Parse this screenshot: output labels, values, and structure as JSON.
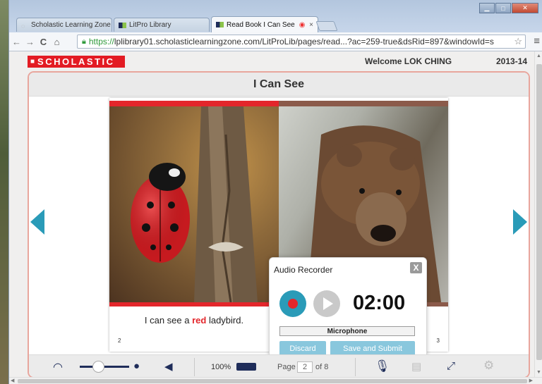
{
  "browser": {
    "tabs": [
      {
        "label": "Scholastic Learning Zone",
        "close": "×"
      },
      {
        "label": "LitPro Library",
        "close": "×"
      },
      {
        "label": "Read Book I Can See",
        "close": "×"
      }
    ],
    "url_scheme": "https://",
    "url_rest": "lplibrary01.scholasticlearningzone.com/LitProLib/pages/read...?ac=259-true&dsRid=897&windowId=s"
  },
  "header": {
    "logo": "SCHOLASTIC",
    "welcome": "Welcome LOK CHING",
    "year": "2013-14"
  },
  "book": {
    "title": "I Can See",
    "left_page": {
      "caption_before": "I can see a ",
      "caption_highlight": "red",
      "caption_after": " ladybird.",
      "page_number": "2"
    },
    "right_page": {
      "page_number": "3"
    }
  },
  "recorder": {
    "title": "Audio Recorder",
    "close_label": "X",
    "timer": "02:00",
    "microphone_label": "Microphone",
    "discard_label": "Discard",
    "submit_label": "Save and Submit"
  },
  "controls": {
    "zoom_label": "100%",
    "page_label": "Page",
    "page_value": "2",
    "page_total": "of 8"
  },
  "colors": {
    "brand_red": "#e31b23",
    "accent_teal": "#2a9bb8",
    "navy": "#1f2d5a"
  }
}
